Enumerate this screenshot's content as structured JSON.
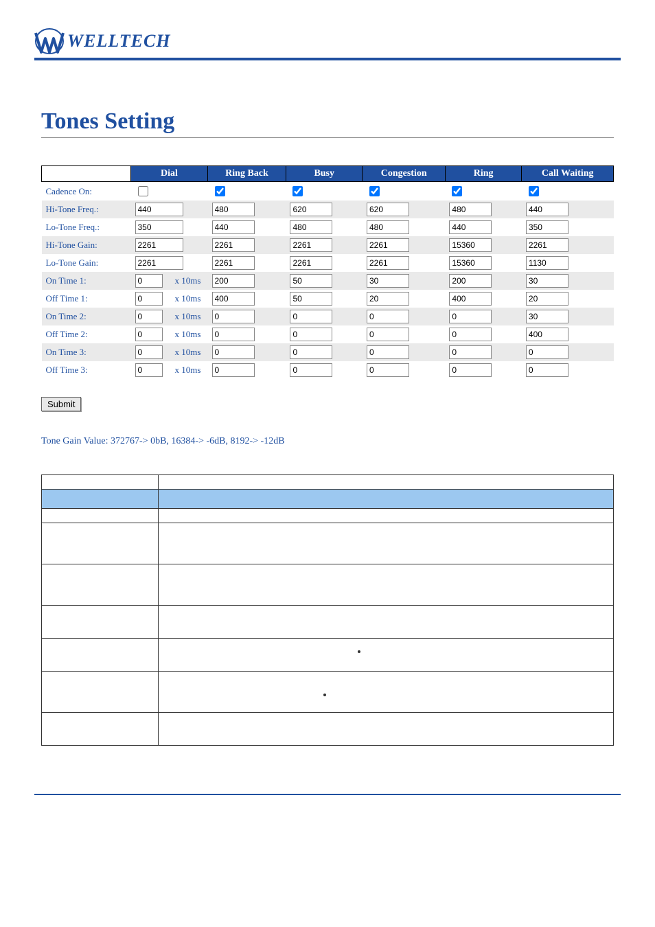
{
  "brand": "WELLTECH",
  "title": "Tones Setting",
  "columns": [
    "Dial",
    "Ring Back",
    "Busy",
    "Congestion",
    "Ring",
    "Call Waiting"
  ],
  "rows": {
    "cadence": {
      "label": "Cadence On:",
      "values_checked": [
        false,
        true,
        true,
        true,
        true,
        true
      ]
    },
    "hi_freq": {
      "label": "Hi-Tone Freq.:",
      "values": [
        "440",
        "480",
        "620",
        "620",
        "480",
        "440"
      ]
    },
    "lo_freq": {
      "label": "Lo-Tone Freq.:",
      "values": [
        "350",
        "440",
        "480",
        "480",
        "440",
        "350"
      ]
    },
    "hi_gain": {
      "label": "Hi-Tone Gain:",
      "values": [
        "2261",
        "2261",
        "2261",
        "2261",
        "15360",
        "2261"
      ]
    },
    "lo_gain": {
      "label": "Lo-Tone Gain:",
      "values": [
        "2261",
        "2261",
        "2261",
        "2261",
        "15360",
        "1130"
      ]
    },
    "on1": {
      "label": "On Time 1:",
      "unit": "x 10ms",
      "values": [
        "0",
        "200",
        "50",
        "30",
        "200",
        "30"
      ]
    },
    "off1": {
      "label": "Off Time 1:",
      "unit": "x 10ms",
      "values": [
        "0",
        "400",
        "50",
        "20",
        "400",
        "20"
      ]
    },
    "on2": {
      "label": "On Time 2:",
      "unit": "x 10ms",
      "values": [
        "0",
        "0",
        "0",
        "0",
        "0",
        "30"
      ]
    },
    "off2": {
      "label": "Off Time 2:",
      "unit": "x 10ms",
      "values": [
        "0",
        "0",
        "0",
        "0",
        "0",
        "400"
      ]
    },
    "on3": {
      "label": "On Time 3:",
      "unit": "x 10ms",
      "values": [
        "0",
        "0",
        "0",
        "0",
        "0",
        "0"
      ]
    },
    "off3": {
      "label": "Off Time 3:",
      "unit": "x 10ms",
      "values": [
        "0",
        "0",
        "0",
        "0",
        "0",
        "0"
      ]
    }
  },
  "submit_label": "Submit",
  "note": "Tone Gain Value: 372767-> 0bB, 16384-> -6dB, 8192-> -12dB",
  "desc_headers": [
    "",
    ""
  ],
  "desc_rows": [
    {
      "field": "",
      "desc": ""
    },
    {
      "field": "",
      "desc": ""
    },
    {
      "field": "",
      "desc": ""
    },
    {
      "field": "",
      "desc": ""
    },
    {
      "field": "",
      "desc": ""
    },
    {
      "field": "",
      "desc": ""
    },
    {
      "field": "",
      "desc": ""
    }
  ]
}
